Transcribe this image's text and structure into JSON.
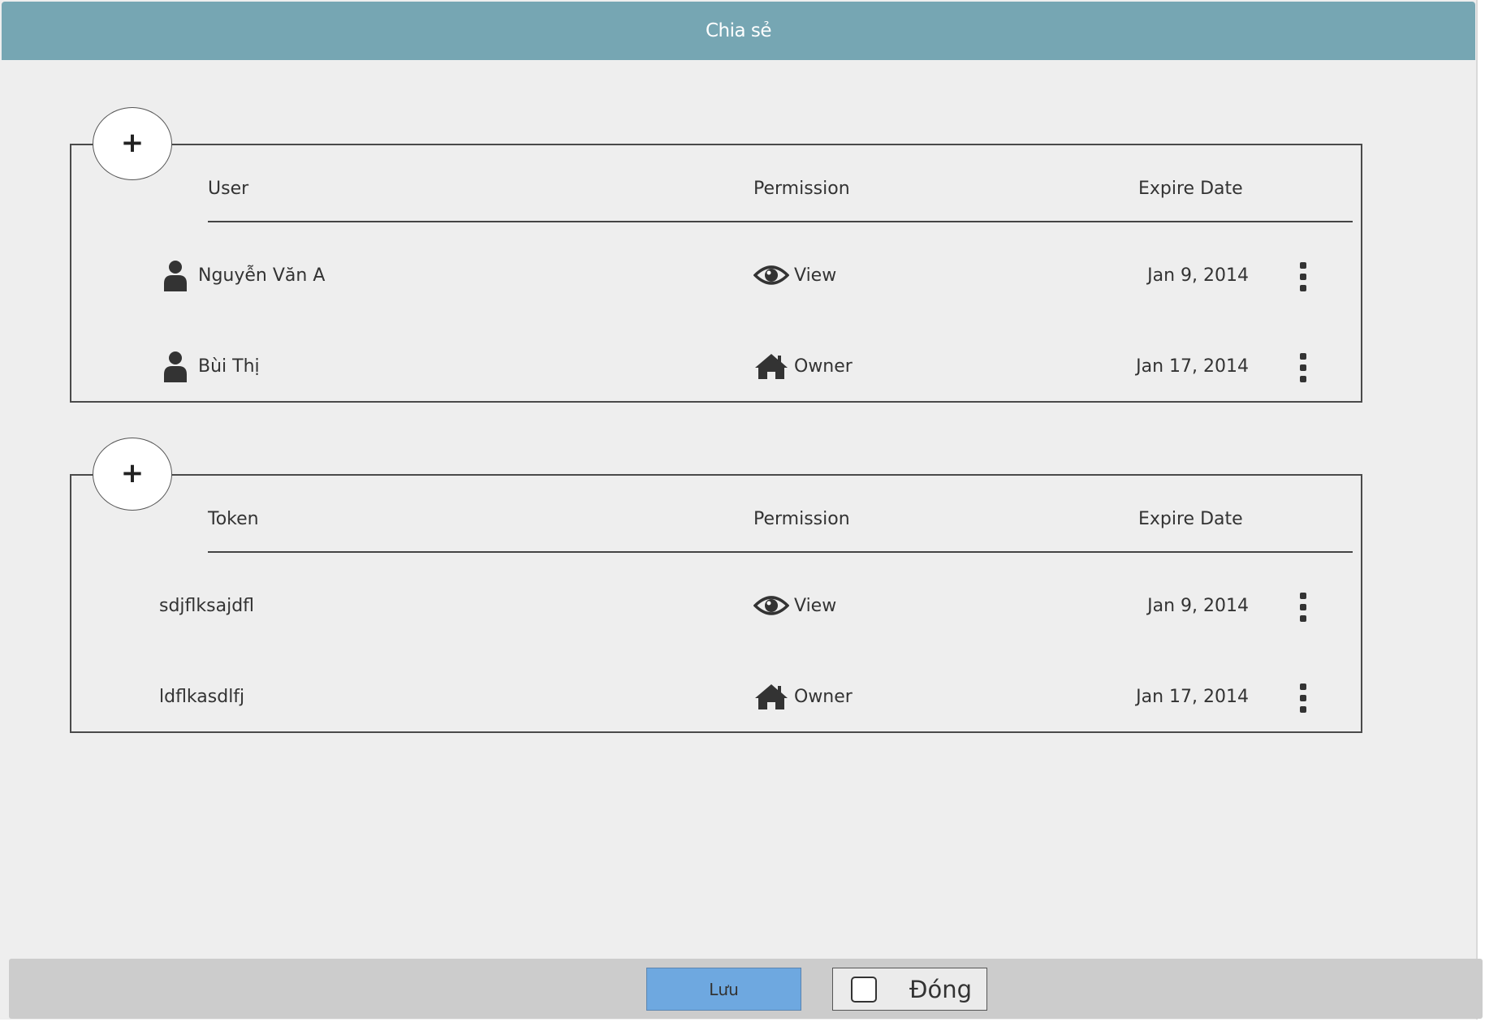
{
  "dialog": {
    "title": "Chia sẻ"
  },
  "users_panel": {
    "add_label": "+",
    "columns": {
      "name": "User",
      "permission": "Permission",
      "expire": "Expire Date"
    },
    "rows": [
      {
        "name": "Nguyễn Văn A",
        "permission": "View",
        "permission_icon": "eye-icon",
        "expire": "Jan 9, 2014"
      },
      {
        "name": "Bùi Thị",
        "permission": "Owner",
        "permission_icon": "home-icon",
        "expire": "Jan 17, 2014"
      }
    ]
  },
  "tokens_panel": {
    "add_label": "+",
    "columns": {
      "name": "Token",
      "permission": "Permission",
      "expire": "Expire Date"
    },
    "rows": [
      {
        "name": "sdjflksajdfl",
        "permission": "View",
        "permission_icon": "eye-icon",
        "expire": "Jan 9, 2014"
      },
      {
        "name": "ldflkasdlfj",
        "permission": "Owner",
        "permission_icon": "home-icon",
        "expire": "Jan 17, 2014"
      }
    ]
  },
  "footer": {
    "save_label": "Lưu",
    "close_label": "Đóng"
  }
}
